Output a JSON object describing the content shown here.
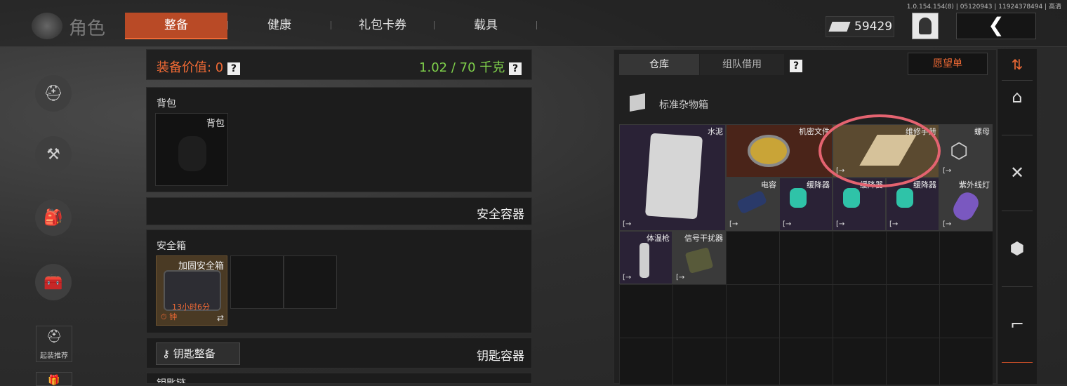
{
  "version": "1.0.154.154(8) | 05120943 | 11924378494 | 高清",
  "header": {
    "title": "角色",
    "tabs": [
      {
        "label": "整备",
        "active": true
      },
      {
        "label": "健康",
        "active": false
      },
      {
        "label": "礼包卡券",
        "active": false
      },
      {
        "label": "载具",
        "active": false
      }
    ],
    "money": "59429",
    "back_icon": "chevron-left-icon"
  },
  "left_sidebar": {
    "icons": [
      "helmet-gun-icon",
      "gear-bundle-icon",
      "backpack-icon",
      "toolbox-icon"
    ],
    "active_index": 2,
    "buttons": [
      {
        "label": "起装推荐",
        "icon": "helmet-icon"
      },
      {
        "label": "",
        "icon": "gift-icon"
      }
    ]
  },
  "equipment": {
    "value_label": "装备价值: 0",
    "weight_label": "1.02 / 70 千克",
    "backpack_section": "背包",
    "backpack_slot": "背包",
    "safe_container_title": "安全容器",
    "safe_box_section": "安全箱",
    "safe_box_item": "加固安全箱",
    "safe_box_timer": "13小时6分",
    "safe_box_timer2": "钟",
    "key_button": "钥匙整备",
    "key_container_title": "钥匙容器",
    "keychain_section": "钥匙链"
  },
  "warehouse": {
    "tabs": [
      {
        "label": "仓库",
        "active": true
      },
      {
        "label": "组队借用",
        "active": false
      }
    ],
    "wishlist": "愿望单",
    "box_label": "标准杂物箱",
    "items": [
      {
        "name": "水泥",
        "rarity": "purple"
      },
      {
        "name": "机密文件",
        "rarity": "red"
      },
      {
        "name": "维修手册",
        "rarity": "gold"
      },
      {
        "name": "螺母",
        "rarity": "grey"
      },
      {
        "name": "电容",
        "rarity": "grey"
      },
      {
        "name": "缓降器",
        "rarity": "purple"
      },
      {
        "name": "缓降器",
        "rarity": "purple"
      },
      {
        "name": "缓降器",
        "rarity": "purple"
      },
      {
        "name": "紫外线灯",
        "rarity": "grey"
      },
      {
        "name": "体温枪",
        "rarity": "purple"
      },
      {
        "name": "信号干扰器",
        "rarity": "grey"
      }
    ],
    "transfer_mark": "[→"
  },
  "right_rail": {
    "icons": [
      "sort-icon",
      "home-icon",
      "fork-knife-icon",
      "box-icon",
      "rifle-icon"
    ]
  },
  "colors": {
    "accent": "#f06a35",
    "active_tab": "#b94a26",
    "weight": "#7fd14b",
    "highlight_circle": "#e46370"
  }
}
